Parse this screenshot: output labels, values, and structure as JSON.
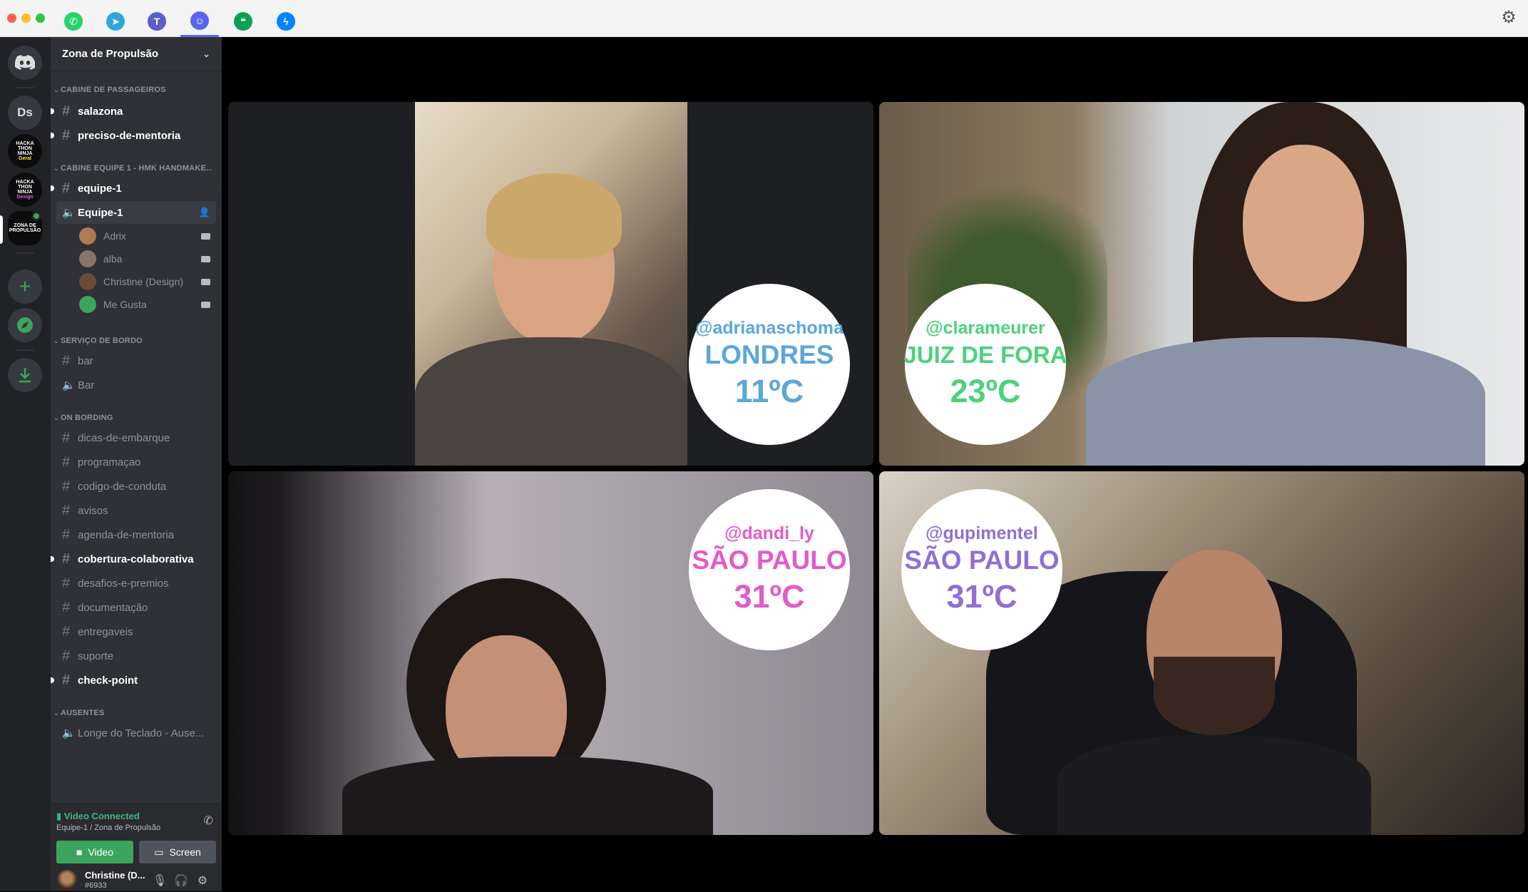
{
  "app_bar": {
    "apps": [
      {
        "name": "whatsapp-icon",
        "color": "#25d366",
        "glyph": "✆"
      },
      {
        "name": "telegram-icon",
        "color": "#2ea6da",
        "glyph": "➤"
      },
      {
        "name": "teams-icon",
        "color": "#5b5fc7",
        "glyph": "T"
      },
      {
        "name": "discord-icon",
        "color": "#5865f2",
        "glyph": "☺"
      },
      {
        "name": "hangouts-icon",
        "color": "#0f9d58",
        "glyph": "❝"
      },
      {
        "name": "messenger-icon",
        "color": "#0084ff",
        "glyph": "ϟ"
      }
    ],
    "active_index": 3
  },
  "servers": {
    "ds_label": "Ds",
    "hmk_geral_lines": [
      "HACKA",
      "THON",
      "NINJA",
      "Geral"
    ],
    "hmk_design_lines": [
      "HACKA",
      "THON",
      "NINJA",
      "Design"
    ],
    "zona_lines": [
      "ZONA DE",
      "PROPULSÃO"
    ]
  },
  "sidebar": {
    "guild_name": "Zona de Propulsão",
    "categories": {
      "cabine_passageiros": "CABINE DE PASSAGEIROS",
      "cabine_equipe": "CABINE EQUIPE 1 - HMK HANDMAKE...",
      "servico_bordo": "SERVIÇO DE BORDO",
      "on_bording": "ON BORDING",
      "ausentes": "AUSENTES"
    },
    "channels": {
      "salazona": "salazona",
      "preciso": "preciso-de-mentoria",
      "equipe_text": "equipe-1",
      "equipe_voice": "Equipe-1",
      "bar_text": "bar",
      "bar_voice": "Bar",
      "dicas": "dicas-de-embarque",
      "programacao": "programaçao",
      "codigo": "codigo-de-conduta",
      "avisos": "avisos",
      "agenda": "agenda-de-mentoria",
      "cobertura": "cobertura-colaborativa",
      "desafios": "desafios-e-premios",
      "documentacao": "documentação",
      "entregaveis": "entregaveis",
      "suporte": "suporte",
      "checkpoint": "check-point",
      "longe": "Longe do Teclado - Ause..."
    },
    "voice_users": [
      {
        "name": "Adrix",
        "avatar": "#b07a52"
      },
      {
        "name": "alba",
        "avatar": "#8a7466"
      },
      {
        "name": "Christine (Design)",
        "avatar": "#6b4a36"
      },
      {
        "name": "Me Gusta",
        "avatar": "#3ba55d"
      }
    ]
  },
  "voice_panel": {
    "status": "Video Connected",
    "location": "Equipe-1 / Zona de Propulsão",
    "video_label": "Video",
    "screen_label": "Screen"
  },
  "user": {
    "name": "Christine (D...",
    "tag": "#6933"
  },
  "participants": [
    {
      "handle": "@adrianaschoma",
      "city": "LONDRES",
      "temp": "11ºC",
      "color": "#5ba7d8"
    },
    {
      "handle": "@clarameurer",
      "city": "JUIZ DE FORA",
      "temp": "23ºC",
      "color": "#4dd17d"
    },
    {
      "handle": "@dandi_ly",
      "city": "SÃO PAULO",
      "temp": "31ºC",
      "color": "#e25bc9"
    },
    {
      "handle": "@gupimentel",
      "city": "SÃO PAULO",
      "temp": "31ºC",
      "color": "#8f6fd6"
    }
  ]
}
